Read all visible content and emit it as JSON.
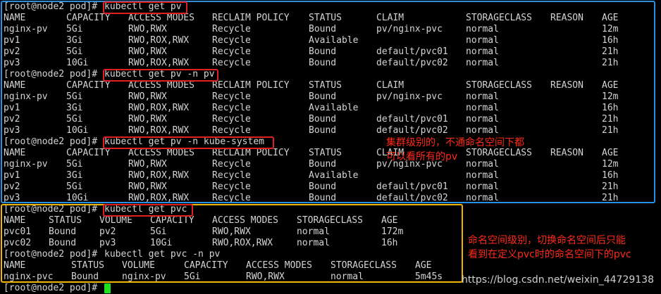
{
  "prompt": "[root@node2 pod]# ",
  "commands": {
    "pv": "kubectl get pv",
    "pv_ns": "kubectl get pv -n pv",
    "pv_kube_system": "kubectl get pv -n kube-system",
    "pvc": "kubectl get pvc",
    "pvc_ns": "kubectl get pvc -n pv"
  },
  "pv_table": {
    "headers": [
      "NAME",
      "CAPACITY",
      "ACCESS MODES",
      "RECLAIM POLICY",
      "STATUS",
      "CLAIM",
      "STORAGECLASS",
      "REASON",
      "AGE"
    ],
    "rows": [
      [
        "nginx-pv",
        "5Gi",
        "RWO,RWX",
        "Recycle",
        "Bound",
        "pv/nginx-pvc",
        "normal",
        "",
        "12m"
      ],
      [
        "pv1",
        "3Gi",
        "RWO,ROX,RWX",
        "Recycle",
        "Available",
        "",
        "normal",
        "",
        "16h"
      ],
      [
        "pv2",
        "5Gi",
        "RWO,RWX",
        "Recycle",
        "Bound",
        "default/pvc01",
        "normal",
        "",
        "21h"
      ],
      [
        "pv3",
        "10Gi",
        "RWO,ROX,RWX",
        "Recycle",
        "Bound",
        "default/pvc02",
        "normal",
        "",
        "21h"
      ]
    ]
  },
  "pvc_table": {
    "headers": [
      "NAME",
      "STATUS",
      "VOLUME",
      "CAPACITY",
      "ACCESS MODES",
      "STORAGECLASS",
      "AGE"
    ],
    "rows": [
      [
        "pvc01",
        "Bound",
        "pv2",
        "5Gi",
        "RWO,RWX",
        "normal",
        "172m"
      ],
      [
        "pvc02",
        "Bound",
        "pv3",
        "10Gi",
        "RWO,ROX,RWX",
        "normal",
        "16h"
      ]
    ]
  },
  "pvc_ns_table": {
    "headers": [
      "NAME",
      "STATUS",
      "VOLUME",
      "CAPACITY",
      "ACCESS MODES",
      "STORAGECLASS",
      "AGE"
    ],
    "rows": [
      [
        "nginx-pvc",
        "Bound",
        "nginx-pv",
        "5Gi",
        "RWO,RWX",
        "normal",
        "5m45s"
      ]
    ]
  },
  "annotations": {
    "pv_note": [
      "集群级别的，不通命名空间下都",
      "可以看所有的pv"
    ],
    "pvc_note": [
      "命名空间级别，切换命名空间后只能",
      "看到在定义pvc时的命名空间下的pvc"
    ]
  },
  "watermark": "https://blog.csdn.net/weixin_44729138",
  "colors": {
    "blue_box": "#2b8fe0",
    "yellow_box": "#f2b600",
    "highlight": "#e02020",
    "annotation": "#ff2a1a",
    "cursor": "#1ee01e",
    "text": "#d4d4d4"
  }
}
